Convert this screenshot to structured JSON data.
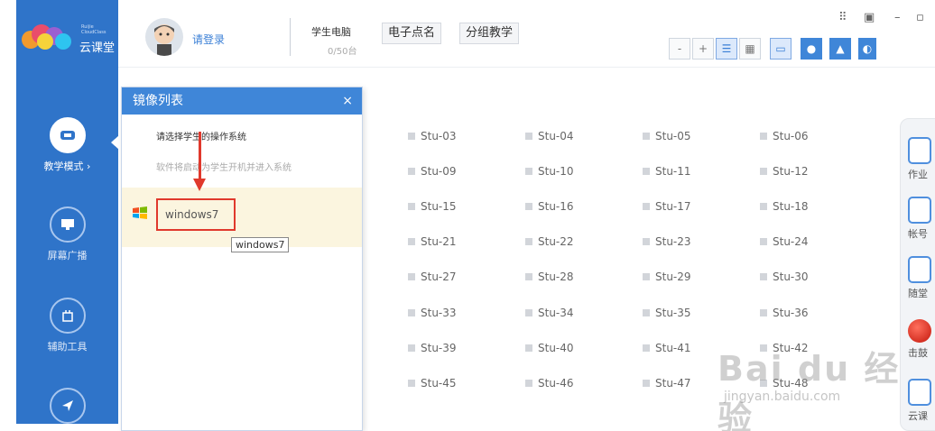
{
  "app": {
    "logo_small": "Ruijie CloudClass",
    "logo_text": "云课堂"
  },
  "sidebar": {
    "items": [
      {
        "label": "教学模式 ›",
        "icon": "teaching-mode-icon"
      },
      {
        "label": "屏幕广播",
        "icon": "screen-broadcast-icon"
      },
      {
        "label": "辅助工具",
        "icon": "assist-tools-icon"
      },
      {
        "label": "",
        "icon": "send-icon"
      }
    ]
  },
  "topbar": {
    "login_label": "请登录",
    "student_pc_title": "学生电脑",
    "student_pc_count": "0/50台",
    "roll_call_label": "电子点名",
    "group_teaching_label": "分组教学",
    "zoom_out_label": "-",
    "zoom_in_label": "+"
  },
  "students": [
    [
      "Stu-03",
      "Stu-04",
      "Stu-05",
      "Stu-06"
    ],
    [
      "Stu-09",
      "Stu-10",
      "Stu-11",
      "Stu-12"
    ],
    [
      "Stu-15",
      "Stu-16",
      "Stu-17",
      "Stu-18"
    ],
    [
      "Stu-21",
      "Stu-22",
      "Stu-23",
      "Stu-24"
    ],
    [
      "Stu-27",
      "Stu-28",
      "Stu-29",
      "Stu-30"
    ],
    [
      "Stu-33",
      "Stu-34",
      "Stu-35",
      "Stu-36"
    ],
    [
      "Stu-39",
      "Stu-40",
      "Stu-41",
      "Stu-42"
    ],
    [
      "Stu-45",
      "Stu-46",
      "Stu-47",
      "Stu-48"
    ]
  ],
  "right_panel": {
    "items": [
      "作业",
      "帐号",
      "随堂",
      "击鼓",
      "云课"
    ]
  },
  "popup": {
    "title": "镜像列表",
    "close": "×",
    "subtitle": "请选择学生的操作系统",
    "hint": "软件将启动为学生开机并进入系统",
    "os_option": "windows7",
    "tooltip": "windows7"
  },
  "watermark": {
    "brand": "Bai du 经验",
    "url": "jingyan.baidu.com"
  },
  "colors": {
    "sidebar": "#2f74c9",
    "accent": "#3f86d8",
    "highlight_box": "#e0392c",
    "selected_row": "#fbf5df"
  }
}
